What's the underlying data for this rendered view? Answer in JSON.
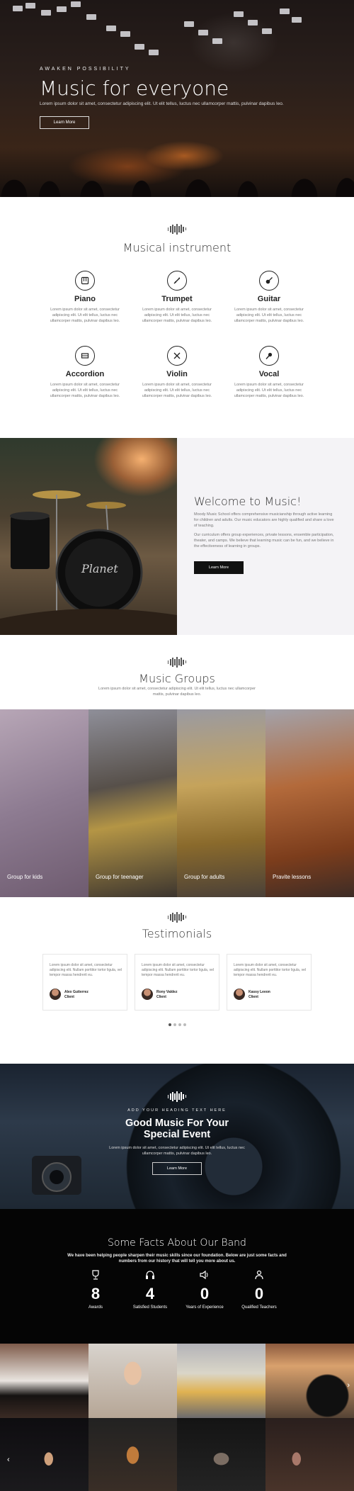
{
  "hero": {
    "eyebrow": "AWAKEN POSSIBILITY",
    "title": "Music for everyone",
    "subtitle": "Lorem ipsum dolor sit amet, consectetur adipiscing elit. Ut elit tellus, luctus nec ullamcorper mattis, pulvinar dapibus leo.",
    "button": "Learn More"
  },
  "instruments": {
    "title": "Musical instrument",
    "items": [
      {
        "name": "Piano",
        "icon": "piano-icon",
        "desc": "Lorem ipsum dolor sit amet, consectetur adipiscing elit. Ut elit tellus, luctus nec ullamcorper mattis, pulvinar dapibus leo."
      },
      {
        "name": "Trumpet",
        "icon": "trumpet-icon",
        "desc": "Lorem ipsum dolor sit amet, consectetur adipiscing elit. Ut elit tellus, luctus nec ullamcorper mattis, pulvinar dapibus leo."
      },
      {
        "name": "Guitar",
        "icon": "guitar-icon",
        "desc": "Lorem ipsum dolor sit amet, consectetur adipiscing elit. Ut elit tellus, luctus nec ullamcorper mattis, pulvinar dapibus leo."
      },
      {
        "name": "Accordion",
        "icon": "accordion-icon",
        "desc": "Lorem ipsum dolor sit amet, consectetur adipiscing elit. Ut elit tellus, luctus nec ullamcorper mattis, pulvinar dapibus leo."
      },
      {
        "name": "Violin",
        "icon": "violin-icon",
        "desc": "Lorem ipsum dolor sit amet, consectetur adipiscing elit. Ut elit tellus, luctus nec ullamcorper mattis, pulvinar dapibus leo."
      },
      {
        "name": "Vocal",
        "icon": "microphone-icon",
        "desc": "Lorem ipsum dolor sit amet, consectetur adipiscing elit. Ut elit tellus, luctus nec ullamcorper mattis, pulvinar dapibus leo."
      }
    ]
  },
  "welcome": {
    "title": "Welcome to Music!",
    "p1": "Moody Music School offers comprehensive musicianship through active learning for children and adults. Our music educators are highly qualified and share a love of teaching.",
    "p2": "Our curriculum offers group experiences, private lessons, ensemble participation, theater, and camps. We believe that learning music can be fun, and we believe in the effectiveness of learning in groups.",
    "button": "Learn More",
    "drum_brand": "Planet"
  },
  "groups": {
    "title": "Music Groups",
    "desc": "Lorem ipsum dolor sit amet, consectetur adipiscing elit. Ut elit tellus, luctus nec ullamcorper mattis, pulvinar dapibus leo.",
    "items": [
      "Group for kids",
      "Group for teenager",
      "Group for adults",
      "Pravite lessons"
    ]
  },
  "testimonials": {
    "title": "Testimonials",
    "text": "Lorem ipsum dolor sit amet, consectetur adipiscing elit. Nullam porttitor tortor ligula, vel tempor massa hendrerit eu.",
    "items": [
      {
        "name": "Alex Gutierrez",
        "role": "Client"
      },
      {
        "name": "Rony Valdez",
        "role": "Client"
      },
      {
        "name": "Kassy Leeon",
        "role": "Client"
      }
    ]
  },
  "promo": {
    "eyebrow": "ADD YOUR HEADING TEXT HERE",
    "title_line1": "Good Music For Your",
    "title_line2": "Special Event",
    "subtitle": "Lorem ipsum dolor sit amet, consectetur adipiscing elit. Ut elit tellus, luctus nec ullamcorper mattis, pulvinar dapibus leo.",
    "button": "Learn More"
  },
  "facts": {
    "title": "Some Facts About Our Band",
    "subtitle": "We have been helping people sharpen their music skills since our foundation. Below are just some facts and numbers from our history that will tell you more about us.",
    "items": [
      {
        "value": "8",
        "label": "Awards",
        "icon": "trophy-icon"
      },
      {
        "value": "4",
        "label": "Satisfied Students",
        "icon": "headphones-icon"
      },
      {
        "value": "0",
        "label": "Years of Experience",
        "icon": "speaker-icon"
      },
      {
        "value": "0",
        "label": "Qualified Teachers",
        "icon": "person-icon"
      }
    ]
  },
  "gallery": {
    "prev_icon": "chevron-left-icon",
    "next_icon": "chevron-right-icon"
  },
  "colors": {
    "dark": "#111111",
    "accent": "#ffffff",
    "text": "#333333"
  }
}
